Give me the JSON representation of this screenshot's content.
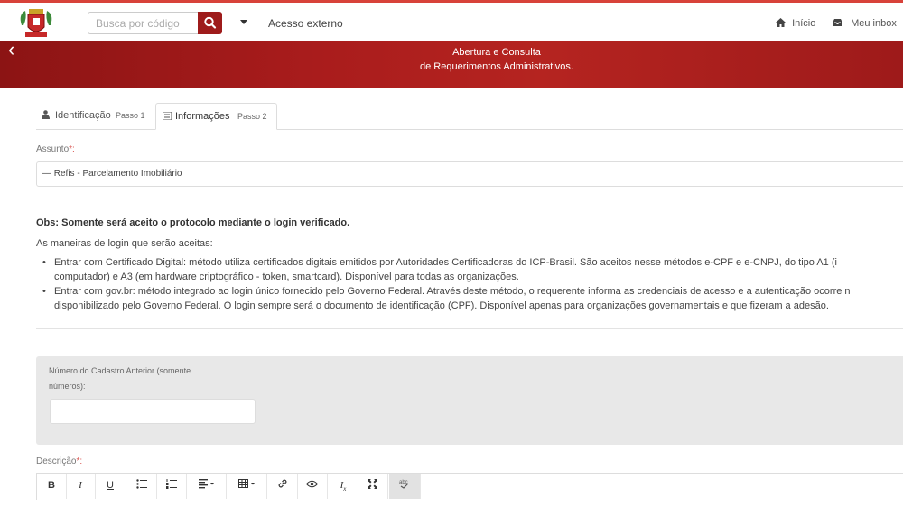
{
  "header": {
    "search_placeholder": "Busca por código",
    "external_access": "Acesso externo",
    "home": "Início",
    "inbox": "Meu inbox"
  },
  "banner": {
    "line1": "Abertura e Consulta",
    "line2": "de Requerimentos Administrativos."
  },
  "tabs": [
    {
      "label": "Identificação",
      "step": "Passo 1",
      "active": false
    },
    {
      "label": "Informações",
      "step": "Passo 2",
      "active": true
    }
  ],
  "form": {
    "subject_label": "Assunto",
    "required_mark": "*:",
    "subject_value": "— Refis - Parcelamento Imobiliário",
    "obs_title": "Obs: Somente será aceito o protocolo mediante o login verificado.",
    "obs_intro": "As maneiras de login que serão aceitas:",
    "bullets": [
      "Entrar com Certificado Digital: método utiliza certificados digitais emitidos por Autoridades Certificadoras do ICP-Brasil. São aceitos nesse métodos e-CPF e e-CNPJ, do tipo A1 (i",
      "computador) e A3 (em hardware criptográfico - token, smartcard). Disponível para todas as organizações.",
      "Entrar com gov.br: método integrado ao login único fornecido pelo Governo Federal. Através deste método, o requerente informa as credenciais de acesso e a autenticação ocorre n",
      "disponibilizado pelo Governo Federal. O login sempre será o documento de identificação (CPF). Disponível apenas para organizações governamentais e que fizeram a adesão."
    ],
    "previous_registry_label_1": "Número do Cadastro Anterior (somente",
    "previous_registry_label_2": "números):",
    "description_label": "Descrição"
  },
  "colors": {
    "accent": "#9e1b1b",
    "banner": "#a91c1c",
    "required": "#d9534f"
  }
}
